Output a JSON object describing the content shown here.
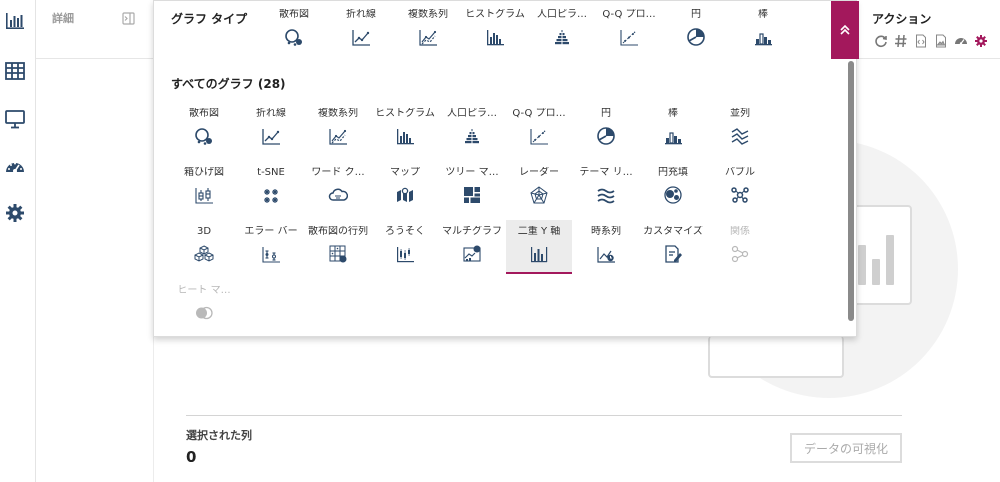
{
  "nav": {
    "items": [
      {
        "name": "chart-icon",
        "active": true
      },
      {
        "name": "table-icon",
        "active": false
      },
      {
        "name": "monitor-icon",
        "active": false
      },
      {
        "name": "dashboard-icon",
        "active": false
      },
      {
        "name": "settings-icon",
        "active": false
      }
    ]
  },
  "details": {
    "label": "詳細"
  },
  "panel": {
    "graph_type_label": "グラフ タイプ",
    "all_graphs_heading": "すべてのグラフ (28)",
    "top_types": [
      {
        "label": "散布図",
        "icon": "scatter-icon"
      },
      {
        "label": "折れ線",
        "icon": "line-icon"
      },
      {
        "label": "複数系列",
        "icon": "multi-series-icon"
      },
      {
        "label": "ヒストグラム",
        "icon": "histogram-icon"
      },
      {
        "label": "人口ピラ…",
        "icon": "pyramid-icon"
      },
      {
        "label": "Q-Q プロ…",
        "icon": "qq-plot-icon"
      },
      {
        "label": "円",
        "icon": "pie-icon"
      },
      {
        "label": "棒",
        "icon": "bar-icon"
      }
    ],
    "all_types": [
      {
        "label": "散布図",
        "icon": "scatter-icon"
      },
      {
        "label": "折れ線",
        "icon": "line-icon"
      },
      {
        "label": "複数系列",
        "icon": "multi-series-icon"
      },
      {
        "label": "ヒストグラム",
        "icon": "histogram-icon"
      },
      {
        "label": "人口ピラ…",
        "icon": "pyramid-icon"
      },
      {
        "label": "Q-Q プロ…",
        "icon": "qq-plot-icon"
      },
      {
        "label": "円",
        "icon": "pie-icon"
      },
      {
        "label": "棒",
        "icon": "bar-icon"
      },
      {
        "label": "並列",
        "icon": "parallel-icon"
      },
      {
        "label": "箱ひげ図",
        "icon": "boxplot-icon"
      },
      {
        "label": "t-SNE",
        "icon": "tsne-icon"
      },
      {
        "label": "ワード ク…",
        "icon": "word-cloud-icon"
      },
      {
        "label": "マップ",
        "icon": "map-icon"
      },
      {
        "label": "ツリー マ…",
        "icon": "treemap-icon"
      },
      {
        "label": "レーダー",
        "icon": "radar-icon"
      },
      {
        "label": "テーマ リ…",
        "icon": "theme-river-icon"
      },
      {
        "label": "円充填",
        "icon": "circle-packing-icon"
      },
      {
        "label": "バブル",
        "icon": "bubble-icon"
      },
      {
        "label": "3D",
        "icon": "cubes-3d-icon"
      },
      {
        "label": "エラー バー",
        "icon": "error-bar-icon"
      },
      {
        "label": "散布図の行列",
        "icon": "scatter-matrix-icon"
      },
      {
        "label": "ろうそく",
        "icon": "candlestick-icon"
      },
      {
        "label": "マルチグラフ",
        "icon": "multi-chart-icon"
      },
      {
        "label": "二重 Y 軸",
        "icon": "dual-y-axis-icon",
        "selected": true
      },
      {
        "label": "時系列",
        "icon": "time-series-icon"
      },
      {
        "label": "カスタマイズ",
        "icon": "customize-icon"
      },
      {
        "label": "関係",
        "icon": "relationship-icon",
        "disabled": true
      },
      {
        "label": "ヒート マ…",
        "icon": "heatmap-icon",
        "disabled": true
      }
    ]
  },
  "actions": {
    "title": "アクション",
    "icons": [
      "refresh-icon",
      "hash-icon",
      "code-file-icon",
      "image-file-icon",
      "dashboard-icon",
      "settings-icon"
    ]
  },
  "selection": {
    "label": "選択された列",
    "count": "0",
    "visualize_button": "データの可視化"
  },
  "colors": {
    "accent": "#a3185c",
    "icon": "#2d4a6b"
  }
}
